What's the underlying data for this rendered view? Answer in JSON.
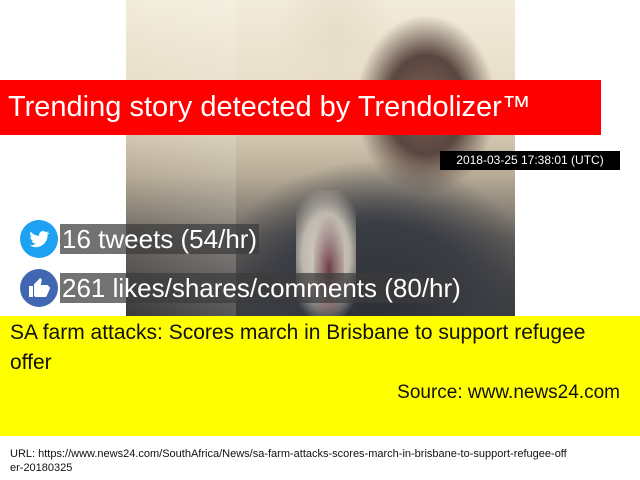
{
  "banner": {
    "text": "Trending story detected by Trendolizer™"
  },
  "timestamp": "2018-03-25 17:38:01 (UTC)",
  "stats": {
    "tweets": {
      "icon": "twitter-bird-icon",
      "text": "16 tweets (54/hr)"
    },
    "likes": {
      "icon": "thumbs-up-icon",
      "text": "261 likes/shares/comments (80/hr)"
    }
  },
  "article": {
    "headline": "SA farm attacks: Scores march in Brisbane to support refugee offer",
    "source": "Source: www.news24.com",
    "url": "URL: https://www.news24.com/SouthAfrica/News/sa-farm-attacks-scores-march-in-brisbane-to-support-refugee-offer-20180325"
  },
  "colors": {
    "banner_bg": "#ff0000",
    "highlight_bg": "#ffff00",
    "twitter_blue": "#1da1f2",
    "facebook_blue": "#4267b2"
  }
}
